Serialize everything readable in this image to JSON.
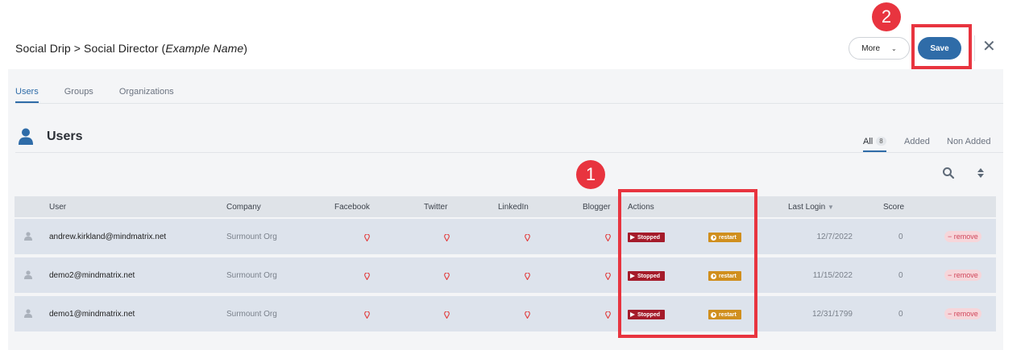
{
  "header": {
    "breadcrumb_prefix": "Social Drip > Social Director (",
    "breadcrumb_name": "Example Name",
    "breadcrumb_suffix": ")",
    "more_label": "More",
    "save_label": "Save"
  },
  "tabs": [
    {
      "label": "Users",
      "active": true
    },
    {
      "label": "Groups",
      "active": false
    },
    {
      "label": "Organizations",
      "active": false
    }
  ],
  "section": {
    "title": "Users",
    "filters": {
      "all": "All",
      "all_count": "8",
      "added": "Added",
      "non_added": "Non Added"
    }
  },
  "table": {
    "headers": {
      "user": "User",
      "company": "Company",
      "facebook": "Facebook",
      "twitter": "Twitter",
      "linkedin": "LinkedIn",
      "blogger": "Blogger",
      "actions": "Actions",
      "last_login": "Last Login",
      "score": "Score"
    },
    "rows": [
      {
        "email": "andrew.kirkland@mindmatrix.net",
        "company": "Surmount Org",
        "stopped": "Stopped",
        "restart": "restart",
        "last_login": "12/7/2022",
        "score": "0",
        "remove": "remove"
      },
      {
        "email": "demo2@mindmatrix.net",
        "company": "Surmount Org",
        "stopped": "Stopped",
        "restart": "restart",
        "last_login": "11/15/2022",
        "score": "0",
        "remove": "remove"
      },
      {
        "email": "demo1@mindmatrix.net",
        "company": "Surmount Org",
        "stopped": "Stopped",
        "restart": "restart",
        "last_login": "12/31/1799",
        "score": "0",
        "remove": "remove"
      }
    ]
  },
  "annotations": {
    "one": "1",
    "two": "2"
  },
  "colors": {
    "accent": "#2f6ca8",
    "annotation": "#e8343f",
    "stopped": "#a51b2a",
    "restart": "#d08f1e"
  }
}
